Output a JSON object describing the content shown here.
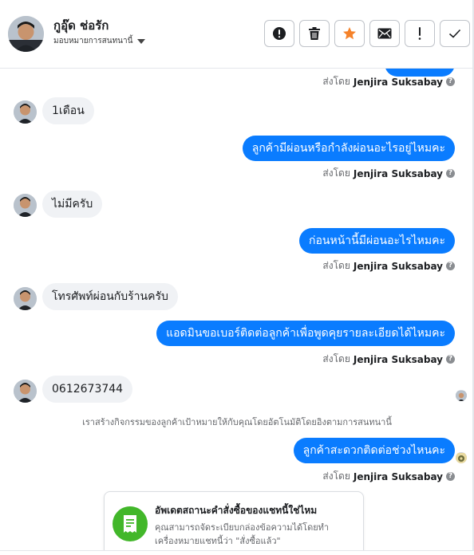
{
  "header": {
    "contact_name": "กูอุ๊ด ช่อรัก",
    "assign_label": "มอบหมายการสนทนานี้",
    "toolbar": [
      {
        "name": "report-spam-button",
        "icon": "alert-circle-icon"
      },
      {
        "name": "delete-button",
        "icon": "trash-icon"
      },
      {
        "name": "star-button",
        "icon": "star-icon"
      },
      {
        "name": "mark-unread-button",
        "icon": "envelope-icon"
      },
      {
        "name": "follow-up-button",
        "icon": "exclamation-icon"
      },
      {
        "name": "done-button",
        "icon": "check-icon"
      }
    ]
  },
  "colors": {
    "outgoing_bubble": "#0a7cff",
    "incoming_bubble": "#f0f2f5",
    "star": "#f5822a",
    "card_icon_bg": "#42b72a"
  },
  "sent_by": {
    "prefix": "ส่งโดย",
    "name": "Jenjira Suksabay",
    "help": "?"
  },
  "messages": [
    {
      "kind": "in",
      "text": "1เดือน"
    },
    {
      "kind": "out",
      "text": "ลูกค้ามีผ่อนหรือกำลังผ่อนอะไรอยู่ไหมคะ"
    },
    {
      "kind": "in",
      "text": "ไม่มีครับ"
    },
    {
      "kind": "out",
      "text": "ก่อนหน้านี้มีผ่อนอะไรไหมคะ"
    },
    {
      "kind": "in",
      "text": "โทรศัพท์ผ่อนกับร้านครับ"
    },
    {
      "kind": "out",
      "text": "แอดมินขอเบอร์ติดต่อลูกค้าเพื่อพูดคุยรายละเอียดได้ไหมคะ"
    },
    {
      "kind": "in",
      "text": "0612673744"
    },
    {
      "kind": "out",
      "text": "ลูกค้าสะดวกติดต่อช่วงไหนคะ"
    }
  ],
  "system_note": "เราสร้างกิจกรรมของลูกค้าเป้าหมายให้กับคุณโดยอัตโนมัติโดยอิงตามการสนทนานี้",
  "order_card": {
    "icon": "receipt-icon",
    "title": "อัพเดตสถานะคำสั่งซื้อของแชทนี้ใช่ไหม",
    "description": "คุณสามารถจัดระเบียบกล่องข้อความได้โดยทำเครื่องหมายแชทนี้ว่า \"สั่งซื้อแล้ว\""
  }
}
